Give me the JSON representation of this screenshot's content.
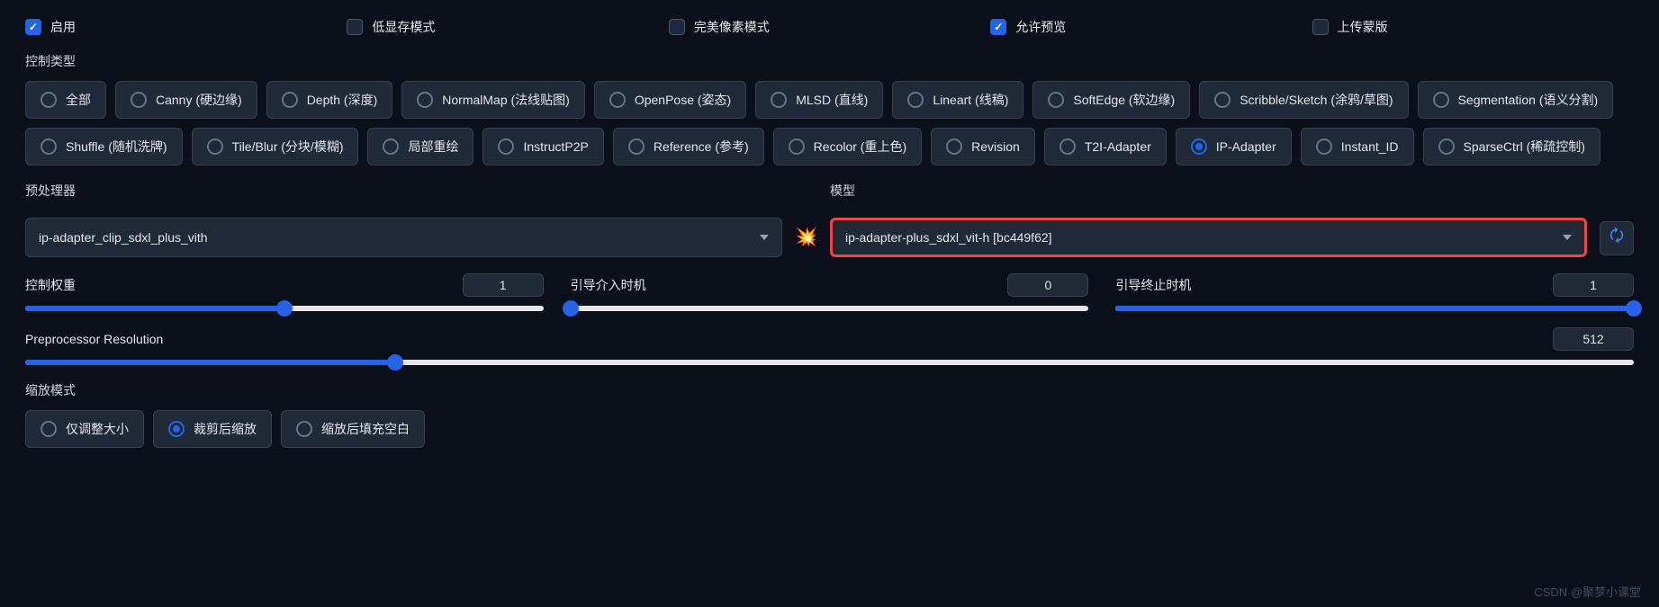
{
  "checkboxes": {
    "enable": {
      "label": "启用",
      "checked": true
    },
    "lowvram": {
      "label": "低显存模式",
      "checked": false
    },
    "pixelperfect": {
      "label": "完美像素模式",
      "checked": false
    },
    "preview": {
      "label": "允许预览",
      "checked": true
    },
    "uploadmask": {
      "label": "上传蒙版",
      "checked": false
    }
  },
  "controlTypeLabel": "控制类型",
  "controlTypes": [
    {
      "label": "全部",
      "selected": false
    },
    {
      "label": "Canny (硬边缘)",
      "selected": false
    },
    {
      "label": "Depth (深度)",
      "selected": false
    },
    {
      "label": "NormalMap (法线贴图)",
      "selected": false
    },
    {
      "label": "OpenPose (姿态)",
      "selected": false
    },
    {
      "label": "MLSD (直线)",
      "selected": false
    },
    {
      "label": "Lineart (线稿)",
      "selected": false
    },
    {
      "label": "SoftEdge (软边缘)",
      "selected": false
    },
    {
      "label": "Scribble/Sketch (涂鸦/草图)",
      "selected": false
    },
    {
      "label": "Segmentation (语义分割)",
      "selected": false
    },
    {
      "label": "Shuffle (随机洗牌)",
      "selected": false
    },
    {
      "label": "Tile/Blur (分块/模糊)",
      "selected": false
    },
    {
      "label": "局部重绘",
      "selected": false
    },
    {
      "label": "InstructP2P",
      "selected": false
    },
    {
      "label": "Reference (参考)",
      "selected": false
    },
    {
      "label": "Recolor (重上色)",
      "selected": false
    },
    {
      "label": "Revision",
      "selected": false
    },
    {
      "label": "T2I-Adapter",
      "selected": false
    },
    {
      "label": "IP-Adapter",
      "selected": true
    },
    {
      "label": "Instant_ID",
      "selected": false
    },
    {
      "label": "SparseCtrl (稀疏控制)",
      "selected": false
    }
  ],
  "preprocessor": {
    "label": "预处理器",
    "value": "ip-adapter_clip_sdxl_plus_vith"
  },
  "boomIcon": "💥",
  "model": {
    "label": "模型",
    "value": "ip-adapter-plus_sdxl_vit-h [bc449f62]"
  },
  "sliders": {
    "weight": {
      "label": "控制权重",
      "value": "1",
      "pct": 50
    },
    "start": {
      "label": "引导介入时机",
      "value": "0",
      "pct": 0
    },
    "end": {
      "label": "引导终止时机",
      "value": "1",
      "pct": 100
    },
    "resolution": {
      "label": "Preprocessor Resolution",
      "value": "512",
      "pct": 23
    }
  },
  "resizeModeLabel": "缩放模式",
  "resizeModes": [
    {
      "label": "仅调整大小",
      "selected": false
    },
    {
      "label": "裁剪后缩放",
      "selected": true
    },
    {
      "label": "缩放后填充空白",
      "selected": false
    }
  ],
  "watermark": "CSDN @聚梦小课堂"
}
